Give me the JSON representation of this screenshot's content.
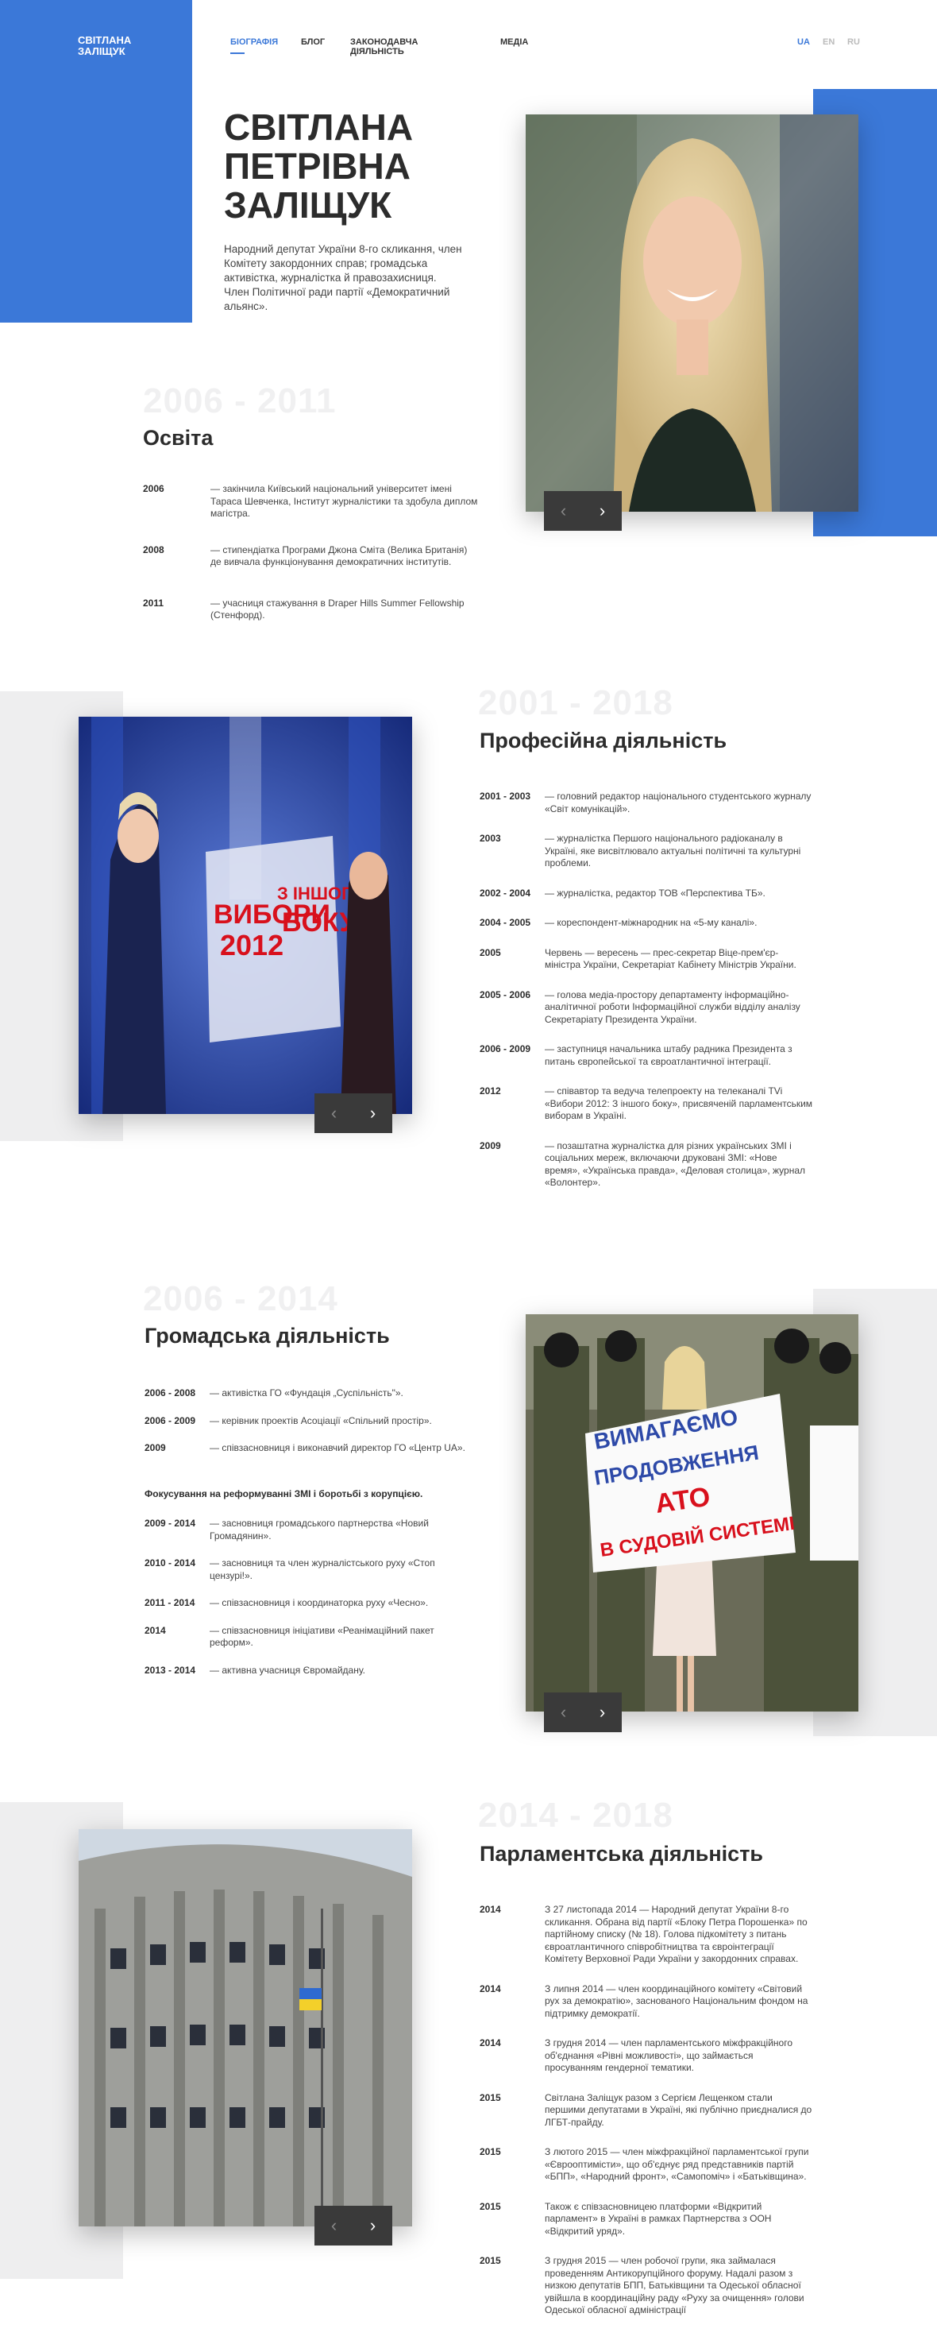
{
  "logo": {
    "line1": "СВІТЛАНА",
    "line2": "ЗАЛІЩУК"
  },
  "nav": {
    "items": [
      "БІОГРАФІЯ",
      "БЛОГ",
      "ЗАКОНОДАВЧА ДІЯЛЬНІСТЬ",
      "МЕДІА"
    ],
    "active_index": 0
  },
  "langs": [
    "UA",
    "EN",
    "RU"
  ],
  "hero": {
    "name_lines": [
      "СВІТЛАНА",
      "ПЕТРІВНА",
      "ЗАЛІЩУК"
    ],
    "description": "Народний депутат України 8-го скликання, член Комітету закордонних справ; громадська активістка, журналістка й правозахисниця. Член Політичної ради партії «Демократичний альянс»."
  },
  "accent_color": "#3b78d8",
  "slider": {
    "prev": "‹",
    "next": "›"
  },
  "education": {
    "years": "2006 - 2011",
    "title": "Освіта",
    "entries": [
      {
        "year": "2006",
        "text": "— закінчила Київський національний університет імені Тараса Шевченка, Інститут журналістики та здобула диплом магістра."
      },
      {
        "year": "2008",
        "text": "— стипендіатка Програми Джона Сміта (Велика Британія) де вивчала функціонування демократичних інститутів."
      },
      {
        "year": "2011",
        "text": "— учасниця стажування в Draper Hills Summer Fellowship (Стенфорд)."
      }
    ]
  },
  "professional": {
    "years": "2001 - 2018",
    "title": "Професійна діяльність",
    "entries": [
      {
        "year": "2001 - 2003",
        "text": "— головний редактор національного студентського журналу «Світ комунікацій»."
      },
      {
        "year": "2003",
        "text": "— журналістка Першого національного радіоканалу в Україні, яке висвітлювало актуальні політичні та культурні проблеми."
      },
      {
        "year": "2002 - 2004",
        "text": "— журналістка, редактор ТОВ «Перспектива ТБ»."
      },
      {
        "year": "2004 - 2005",
        "text": "— кореспондент-міжнародник на «5-му каналі»."
      },
      {
        "year": "2005",
        "text": "Червень — вересень — прес-секретар Віце-прем'єр-міністра України, Секретаріат Кабінету Міністрів України."
      },
      {
        "year": "2005 - 2006",
        "text": "— голова медіа-простору департаменту інформаційно-аналітичної роботи Інформаційної служби відділу аналізу Секретаріату Президента України."
      },
      {
        "year": "2006 - 2009",
        "text": "— заступниця начальника штабу радника Президента з питань європейської та євроатлантичної інтеграції."
      },
      {
        "year": "2012",
        "text": "— співавтор та ведуча телепроекту на телеканалі TVi «Вибори 2012: З іншого боку», присвяченій парламентським виборам в Україні."
      },
      {
        "year": "2009",
        "text": "— позаштатна журналістка для різних українських ЗМІ і соціальних мереж, включаючи друковані ЗМІ: «Нове время», «Українська правда», «Деловая столица», журнал «Волонтер»."
      }
    ]
  },
  "poster": {
    "line1": "ВИБОРИ",
    "line2": "2012",
    "line3": "З ІНШОГО",
    "line4": "БОКУ"
  },
  "civic": {
    "years": "2006 - 2014",
    "title": "Громадська діяльність",
    "entries": [
      {
        "year": "2006 - 2008",
        "text": "— активістка ГО «Фундація „Суспільність\"»."
      },
      {
        "year": "2006 - 2009",
        "text": "— керівник проектів Асоціації «Спільний простір»."
      },
      {
        "year": "2009",
        "text": "— співзасновниця і виконавчий директор ГО «Центр UA»."
      }
    ],
    "note": "Фокусування на реформуванні ЗМІ і боротьбі з корупцією.",
    "entries2": [
      {
        "year": "2009 - 2014",
        "text": "— засновниця громадського партнерства «Новий Громадянин»."
      },
      {
        "year": "2010 - 2014",
        "text": "— засновниця та член журналістського руху «Стоп цензурі!»."
      },
      {
        "year": "2011 - 2014",
        "text": "— співзасновниця і координаторка руху «Чесно»."
      },
      {
        "year": "2014",
        "text": "— співзасновниця ініціативи «Реанімаційний пакет реформ»."
      },
      {
        "year": "2013 - 2014",
        "text": "— активна учасниця Євромайдану."
      }
    ]
  },
  "protest": {
    "line1": "ВИМАГАЄМО",
    "line2": "ПРОДОВЖЕННЯ",
    "line3": "АТО",
    "line4": "В СУДОВІЙ СИСТЕМІ"
  },
  "parliament": {
    "years": "2014 - 2018",
    "title": "Парламентська діяльність",
    "entries": [
      {
        "year": "2014",
        "text": "З 27 листопада 2014 — Народний депутат України 8-го скликання. Обрана від партії «Блоку Петра Порошенка» по партійному списку (№ 18). Голова підкомітету з питань євроатлантичного співробітництва та євроінтеграції Комітету Верховної Ради України у закордонних справах."
      },
      {
        "year": "2014",
        "text": "З липня 2014 — член координаційного комітету «Світовий рух за демократію», заснованого Національним фондом на підтримку демократії."
      },
      {
        "year": "2014",
        "text": "З грудня 2014 — член парламентського міжфракційного об'єднання «Рівні можливості», що займається просуванням гендерної тематики."
      },
      {
        "year": "2015",
        "text": "Світлана Заліщук разом з Сергієм Лещенком стали першими депутатами в Україні, які публічно приєдналися до ЛГБТ-прайду."
      },
      {
        "year": "2015",
        "text": "З лютого 2015 — член міжфракційної парламентської групи «Єврооптимісти», що об'єднує ряд представників партій «БПП», «Народний фронт», «Самопоміч» і «Батьківщина»."
      },
      {
        "year": "2015",
        "text": "Також є співзасновницею платформи «Відкритий парламент» в Україні в рамках Партнерства з ООН «Відкритий уряд»."
      },
      {
        "year": "2015",
        "text": "З грудня 2015 — член робочої групи, яка займалася проведенням Антикорупційного форуму. Надалі разом з низкою депутатів БПП, Батьківщини та Одеської обласної увійшла в координаційну раду «Руху за очищення» голови Одеської обласної адміністрації"
      }
    ]
  }
}
